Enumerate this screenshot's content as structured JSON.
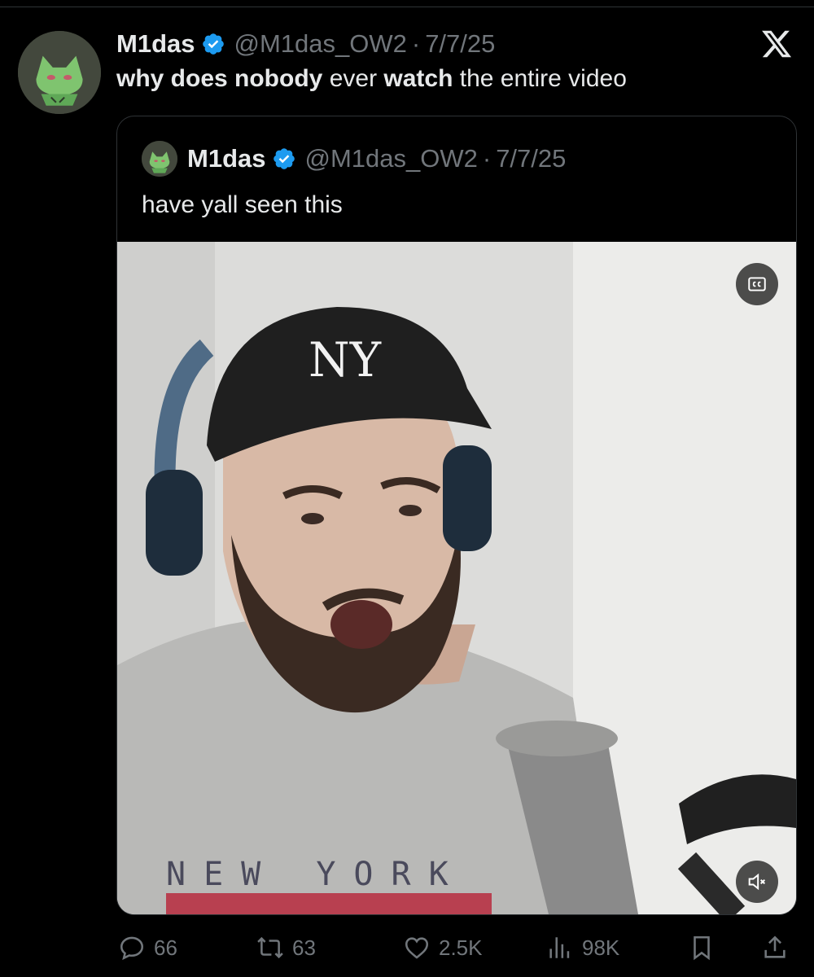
{
  "tweet": {
    "author_name": "M1das",
    "handle": "@M1das_OW2",
    "separator": "·",
    "date": "7/7/25",
    "text_parts": [
      {
        "t": "why does nobody",
        "bold": true
      },
      {
        "t": " ever ",
        "bold": false
      },
      {
        "t": "watch",
        "bold": true
      },
      {
        "t": " the entire video",
        "bold": false
      }
    ]
  },
  "quoted": {
    "author_name": "M1das",
    "handle": "@M1das_OW2",
    "separator": "·",
    "date": "7/7/25",
    "text": "have yall seen this",
    "video": {
      "cc_icon": "closed-captions-icon",
      "mute_icon": "volume-muted-icon",
      "shirt_text_line1": "NEW YORK",
      "cap_logo": "NY"
    }
  },
  "actions": {
    "replies": "66",
    "reposts": "63",
    "likes": "2.5K",
    "views": "98K",
    "icons": [
      "reply-icon",
      "repost-icon",
      "like-icon",
      "views-icon",
      "bookmark-icon",
      "share-icon"
    ]
  },
  "colors": {
    "verified": "#1d9bf0",
    "muted_text": "#71767b",
    "text": "#e7e9ea",
    "background": "#000000"
  }
}
